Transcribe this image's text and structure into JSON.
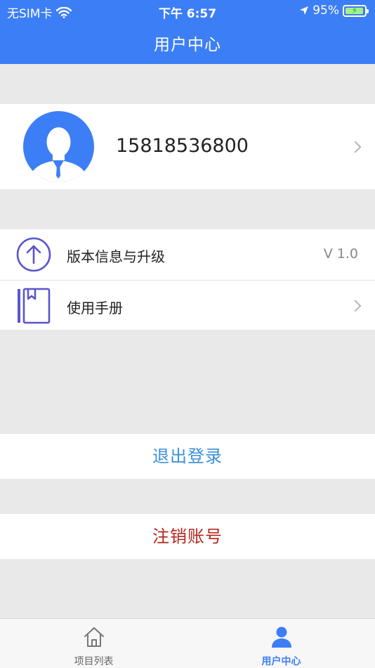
{
  "status_bar": {
    "carrier": "无SIM卡",
    "time": "下午 6:57",
    "battery": "95%",
    "battery_level": 0.95
  },
  "header": {
    "title": "用户中心"
  },
  "profile": {
    "phone": "15818536800"
  },
  "menu": {
    "items": [
      {
        "label": "版本信息与升级",
        "value": "V 1.0",
        "icon": "upload-arrow-icon"
      },
      {
        "label": "使用手册",
        "icon": "book-icon"
      }
    ]
  },
  "actions": {
    "logout": "退出登录",
    "deregister": "注销账号"
  },
  "tabbar": {
    "tabs": [
      {
        "label": "项目列表",
        "icon": "home-icon",
        "active": false
      },
      {
        "label": "用户中心",
        "icon": "user-icon",
        "active": true
      }
    ]
  },
  "colors": {
    "primary": "#3c7ef5",
    "logout_text": "#3a8fd9",
    "deregister_text": "#b3261e",
    "icon_purple": "#5a55cc"
  }
}
